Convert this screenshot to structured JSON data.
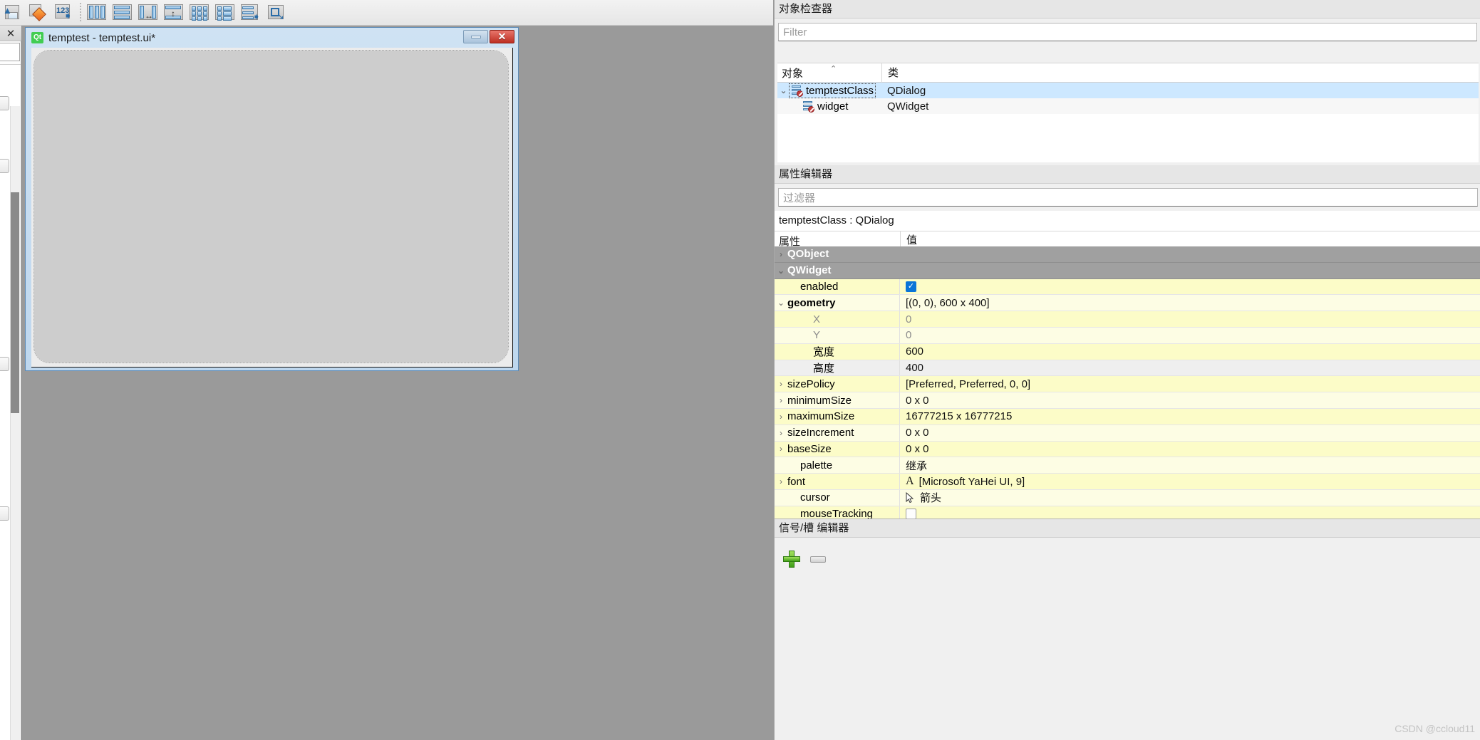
{
  "toolbar": {
    "buttons": [
      {
        "name": "save-form-icon",
        "label": "保存"
      },
      {
        "name": "edit-tag-icon",
        "label": "编辑"
      },
      {
        "name": "tab-order-icon",
        "label": "Tab 顺序"
      },
      {
        "name": "layout-horizontally-icon",
        "label": "水平布局"
      },
      {
        "name": "layout-vertically-icon",
        "label": "垂直布局"
      },
      {
        "name": "layout-horizontal-splitter-icon",
        "label": "使用分裂器水平布局"
      },
      {
        "name": "layout-vertical-splitter-icon",
        "label": "使用分裂器垂直布局"
      },
      {
        "name": "layout-grid-icon",
        "label": "栅格布局"
      },
      {
        "name": "layout-form-icon",
        "label": "表单布局"
      },
      {
        "name": "break-layout-icon",
        "label": "打散布局"
      },
      {
        "name": "adjust-size-icon",
        "label": "调整大小"
      }
    ]
  },
  "left_dock": {
    "close_label": "✕",
    "filter_placeholder": ""
  },
  "form_window": {
    "logo_text": "Qt",
    "title": "temptest - temptest.ui*",
    "minimize_label": "",
    "close_label": "✕"
  },
  "object_inspector": {
    "title": "对象检查器",
    "filter_placeholder": "Filter",
    "columns": [
      "对象",
      "类"
    ],
    "rows": [
      {
        "name": "temptestClass",
        "class": "QDialog",
        "indent": 0,
        "expanded": true,
        "selected": true
      },
      {
        "name": "widget",
        "class": "QWidget",
        "indent": 1,
        "expanded": false,
        "selected": false
      }
    ]
  },
  "property_editor": {
    "title": "属性编辑器",
    "filter_placeholder": "过滤器",
    "subject": "temptestClass : QDialog",
    "columns": [
      "属性",
      "值"
    ],
    "rows": [
      {
        "name": "QObject",
        "value": "",
        "kind": "group",
        "expander": "collapsed",
        "indent": 0
      },
      {
        "name": "QWidget",
        "value": "",
        "kind": "group",
        "expander": "expanded",
        "indent": 0
      },
      {
        "name": "enabled",
        "value": "",
        "kind": "check-on",
        "expander": "none",
        "indent": 1,
        "shade": "y1"
      },
      {
        "name": "geometry",
        "value": "[(0, 0), 600 x 400]",
        "kind": "bold",
        "expander": "expanded",
        "indent": 0,
        "shade": "y2"
      },
      {
        "name": "X",
        "value": "0",
        "kind": "dim",
        "expander": "none",
        "indent": 2,
        "shade": "y1"
      },
      {
        "name": "Y",
        "value": "0",
        "kind": "dim",
        "expander": "none",
        "indent": 2,
        "shade": "y2"
      },
      {
        "name": "宽度",
        "value": "600",
        "kind": "normal",
        "expander": "none",
        "indent": 2,
        "shade": "y1"
      },
      {
        "name": "高度",
        "value": "400",
        "kind": "normal",
        "expander": "none",
        "indent": 2,
        "shade": "g1"
      },
      {
        "name": "sizePolicy",
        "value": "[Preferred, Preferred, 0, 0]",
        "kind": "normal",
        "expander": "collapsed",
        "indent": 0,
        "shade": "y1"
      },
      {
        "name": "minimumSize",
        "value": "0 x 0",
        "kind": "normal",
        "expander": "collapsed",
        "indent": 0,
        "shade": "y2"
      },
      {
        "name": "maximumSize",
        "value": "16777215 x 16777215",
        "kind": "normal",
        "expander": "collapsed",
        "indent": 0,
        "shade": "y1"
      },
      {
        "name": "sizeIncrement",
        "value": "0 x 0",
        "kind": "normal",
        "expander": "collapsed",
        "indent": 0,
        "shade": "y2"
      },
      {
        "name": "baseSize",
        "value": "0 x 0",
        "kind": "normal",
        "expander": "collapsed",
        "indent": 0,
        "shade": "y1"
      },
      {
        "name": "palette",
        "value": "继承",
        "kind": "normal",
        "expander": "none",
        "indent": 1,
        "shade": "y2"
      },
      {
        "name": "font",
        "value": "[Microsoft YaHei UI, 9]",
        "kind": "font",
        "expander": "collapsed",
        "indent": 0,
        "shade": "y1"
      },
      {
        "name": "cursor",
        "value": "箭头",
        "kind": "cursor",
        "expander": "none",
        "indent": 1,
        "shade": "y2"
      },
      {
        "name": "mouseTracking",
        "value": "",
        "kind": "check-off",
        "expander": "none",
        "indent": 1,
        "shade": "y1"
      }
    ]
  },
  "signal_slot_editor": {
    "title": "信号/槽 编辑器",
    "add_label": "",
    "remove_label": ""
  },
  "watermark": "CSDN @ccloud11",
  "colors": {
    "accent_selection": "#cde8ff",
    "group_header": "#a0a0a0",
    "prop_yellow": "#fcfcc8",
    "workspace": "#9a9a9a",
    "qt_green": "#41cd52",
    "close_red": "#bd2f22"
  }
}
